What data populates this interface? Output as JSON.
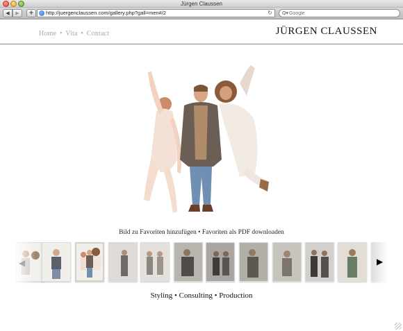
{
  "window": {
    "title": "Jürgen Claussen"
  },
  "toolbar": {
    "back_glyph": "◀",
    "forward_glyph": "▶",
    "add_glyph": "+",
    "url": "http://juergenclaussen.com/gallery.php?gall=men#/2",
    "reload_glyph": "↻",
    "search_icon_glyph": "Q▾",
    "search_placeholder": "Google"
  },
  "site": {
    "nav": [
      {
        "label": "Home"
      },
      {
        "label": "Vita"
      },
      {
        "label": "Contact"
      }
    ],
    "nav_separator": "•",
    "logo": "JÜRGEN CLAUSSEN",
    "favorites_link": "Bild zu Favoriten hinzufügen",
    "pdf_link": "Favoriten als PDF downloaden",
    "link_separator": "•",
    "footer": [
      {
        "label": "Styling"
      },
      {
        "label": "Consulting"
      },
      {
        "label": "Production"
      }
    ],
    "footer_separator": "•"
  },
  "gallery": {
    "prev_glyph": "◀",
    "next_glyph": "▶",
    "thumb_count": 11,
    "active_thumb": 2
  },
  "colors": {
    "nav_text": "#a8a8a8",
    "logo_text": "#111111",
    "rule": "#8a8a8a"
  }
}
